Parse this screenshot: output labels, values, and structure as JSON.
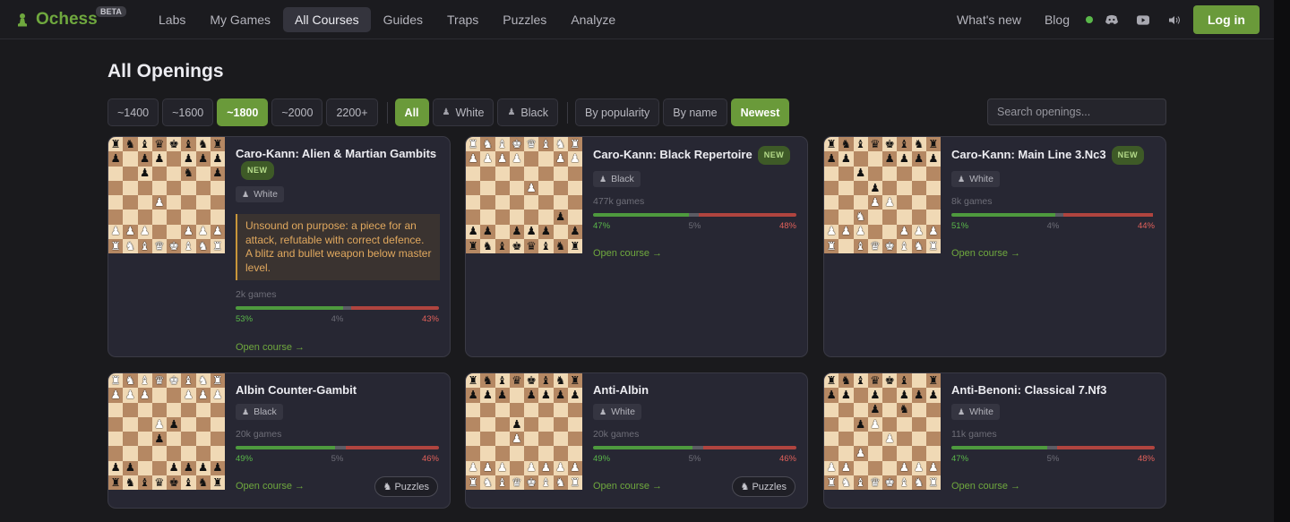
{
  "brand": {
    "name": "Ochess",
    "badge": "BETA",
    "icon": "pawn-icon",
    "accent": "#6fa83e"
  },
  "nav": [
    "Labs",
    "My Games",
    "All Courses",
    "Guides",
    "Traps",
    "Puzzles",
    "Analyze"
  ],
  "nav_active": "All Courses",
  "right_nav": {
    "whats_new": "What's new",
    "blog": "Blog",
    "status_color": "#5ab84a",
    "icons": [
      "discord-icon",
      "youtube-icon",
      "sound-icon"
    ],
    "login": "Log in"
  },
  "page_title": "All Openings",
  "filters": {
    "ratings": [
      {
        "label": "~1400",
        "on": false
      },
      {
        "label": "~1600",
        "on": false
      },
      {
        "label": "~1800",
        "on": true
      },
      {
        "label": "~2000",
        "on": false
      },
      {
        "label": "2200+",
        "on": false
      }
    ],
    "sides": [
      {
        "label": "All",
        "on": true,
        "icon": ""
      },
      {
        "label": "White",
        "on": false,
        "icon": "person-icon"
      },
      {
        "label": "Black",
        "on": false,
        "icon": "person-icon"
      }
    ],
    "sorts": [
      {
        "label": "By popularity",
        "on": false
      },
      {
        "label": "By name",
        "on": false
      },
      {
        "label": "Newest",
        "on": true
      }
    ]
  },
  "search": {
    "placeholder": "Search openings...",
    "value": ""
  },
  "cards": [
    {
      "title": "Caro-Kann: Alien & Martian Gambits",
      "is_new": true,
      "new_label": "NEW",
      "side": "White",
      "note": "Unsound on purpose: a piece for an attack, refutable with correct defence. A blitz and bullet weapon below master level.",
      "games": "2k games",
      "win": "53%",
      "draw": "4%",
      "loss": "43%",
      "win_frac": 0.53,
      "draw_frac": 0.04,
      "loss_frac": 0.43,
      "open": "Open course →",
      "puzzles": "",
      "board": [
        "rnbqkbnr",
        "p.pp.ppp",
        "..p..n.p",
        "........",
        "...P....",
        "........",
        "PPP..PPP",
        "RNBQKBNR"
      ]
    },
    {
      "title": "Caro-Kann: Black Repertoire",
      "is_new": true,
      "new_label": "NEW",
      "side": "Black",
      "note": "",
      "games": "477k games",
      "win": "47%",
      "draw": "5%",
      "loss": "48%",
      "win_frac": 0.47,
      "draw_frac": 0.05,
      "loss_frac": 0.48,
      "open": "Open course →",
      "puzzles": "",
      "board": [
        "RNBKQBNR",
        "PPPP..PP",
        "........",
        "....P...",
        "........",
        "......p.",
        "pp.ppp.p",
        "rnbkqbnr"
      ]
    },
    {
      "title": "Caro-Kann: Main Line 3.Nc3",
      "is_new": true,
      "new_label": "NEW",
      "side": "White",
      "note": "",
      "games": "8k games",
      "win": "51%",
      "draw": "4%",
      "loss": "44%",
      "win_frac": 0.51,
      "draw_frac": 0.04,
      "loss_frac": 0.44,
      "open": "Open course →",
      "puzzles": "",
      "board": [
        "rnbqkbnr",
        "pp..pppp",
        "..p.....",
        "...p....",
        "...PP...",
        "..N.....",
        "PPP..PPP",
        "R.BQKBNR"
      ]
    },
    {
      "title": "Albin Counter-Gambit",
      "is_new": false,
      "new_label": "",
      "side": "Black",
      "note": "",
      "games": "20k games",
      "win": "49%",
      "draw": "5%",
      "loss": "46%",
      "win_frac": 0.49,
      "draw_frac": 0.05,
      "loss_frac": 0.46,
      "open": "Open course →",
      "puzzles": "Puzzles",
      "board": [
        "RNBQKBNR",
        "PPP..PPP",
        "........",
        "...Pp...",
        "...p....",
        "........",
        "pp..pppp",
        "rnbqkbnr"
      ]
    },
    {
      "title": "Anti-Albin",
      "is_new": false,
      "new_label": "",
      "side": "White",
      "note": "",
      "games": "20k games",
      "win": "49%",
      "draw": "5%",
      "loss": "46%",
      "win_frac": 0.49,
      "draw_frac": 0.05,
      "loss_frac": 0.46,
      "open": "Open course →",
      "puzzles": "Puzzles",
      "board": [
        "rnbqkbnr",
        "ppp.pppp",
        "........",
        "...p....",
        "...P....",
        "........",
        "PPP.PPPP",
        "RNBQKBNR"
      ]
    },
    {
      "title": "Anti-Benoni: Classical 7.Nf3",
      "is_new": false,
      "new_label": "",
      "side": "White",
      "note": "",
      "games": "11k games",
      "win": "47%",
      "draw": "5%",
      "loss": "48%",
      "win_frac": 0.47,
      "draw_frac": 0.05,
      "loss_frac": 0.48,
      "open": "Open course →",
      "puzzles": "",
      "board": [
        "rnbqkb.r",
        "pp.p.ppp",
        "...p.n..",
        "..pP....",
        "....P...",
        "..P.....",
        "PP...PPP",
        "RNBQKBNR"
      ]
    }
  ]
}
